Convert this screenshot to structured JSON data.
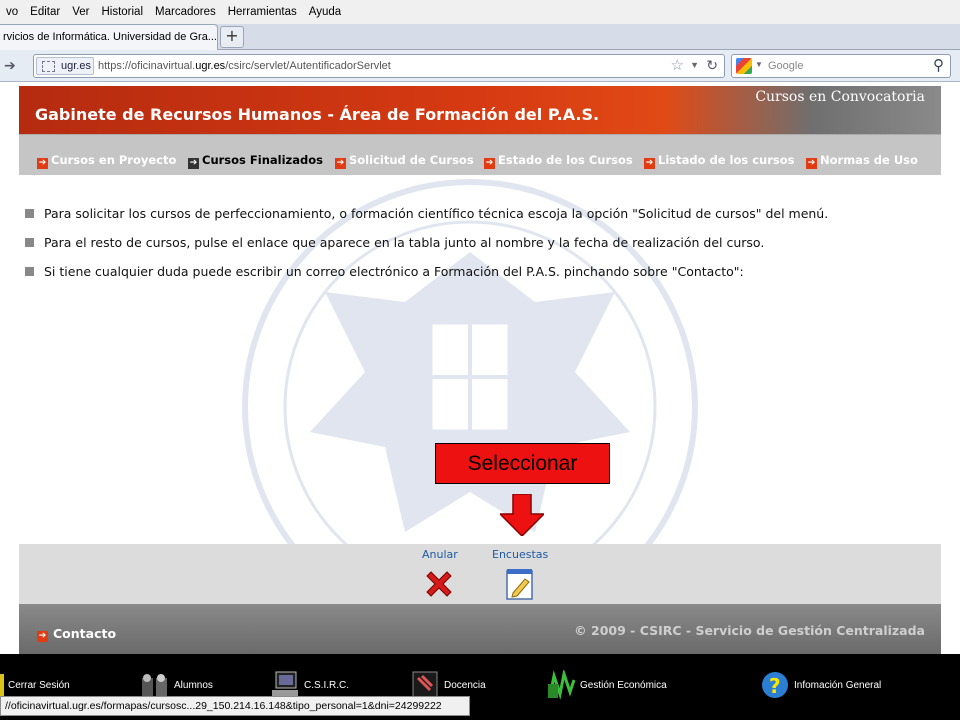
{
  "browser": {
    "menu": [
      "vo",
      "Editar",
      "Ver",
      "Historial",
      "Marcadores",
      "Herramientas",
      "Ayuda"
    ],
    "tab_title": "rvicios de Informática. Universidad de Gra...",
    "newtab_symbol": "+",
    "identity": "ugr.es",
    "url_prefix": "https://oficinavirtual.",
    "url_domain": "ugr.es",
    "url_path": "/csirc/servlet/AutentificadorServlet",
    "search_placeholder": "Google",
    "status_url": "//oficinavirtual.ugr.es/formapas/cursosc...29_150.214.16.148&tipo_personal=1&dni=24299222"
  },
  "header": {
    "title": "Gabinete de Recursos Humanos - Área de Formación del P.A.S.",
    "right_label": "Cursos en Convocatoria"
  },
  "nav": {
    "items": [
      {
        "label": "Cursos en Proyecto"
      },
      {
        "label": "Cursos Finalizados"
      },
      {
        "label": "Solicitud de Cursos"
      },
      {
        "label": "Estado de los Cursos"
      },
      {
        "label": "Listado de los cursos"
      },
      {
        "label": "Normas de Uso"
      }
    ]
  },
  "content": {
    "bullets": [
      "Para solicitar los cursos de perfeccionamiento, o formación científico técnica escoja la opción \"Solicitud de cursos\" del menú.",
      "Para el resto de cursos, pulse el enlace que aparece en la tabla junto al nombre y la fecha de realización del curso.",
      "Si tiene cualquier duda puede escribir un correo electrónico a Formación del P.A.S. pinchando sobre \"Contacto\":"
    ],
    "callout": "Seleccionar"
  },
  "actions": {
    "cancel_label": "Anular",
    "survey_label": "Encuestas"
  },
  "footer": {
    "contact": "Contacto",
    "copyright": "© 2009 - CSIRC - Servicio de Gestión Centralizada"
  },
  "taskbar": {
    "items": [
      {
        "label": "Cerrar Sesión",
        "icon": "logout-icon"
      },
      {
        "label": "Alumnos",
        "icon": "students-icon"
      },
      {
        "label": "C.S.I.R.C.",
        "icon": "computer-icon"
      },
      {
        "label": "Docencia",
        "icon": "teaching-icon"
      },
      {
        "label": "Gestión Económica",
        "icon": "economy-icon"
      },
      {
        "label": "Infomación General",
        "icon": "info-icon"
      }
    ]
  },
  "colors": {
    "header_red": "#d63a12",
    "nav_gray": "#c5c5c5",
    "callout_red": "#ee1111",
    "link_blue": "#1f5aa6"
  }
}
